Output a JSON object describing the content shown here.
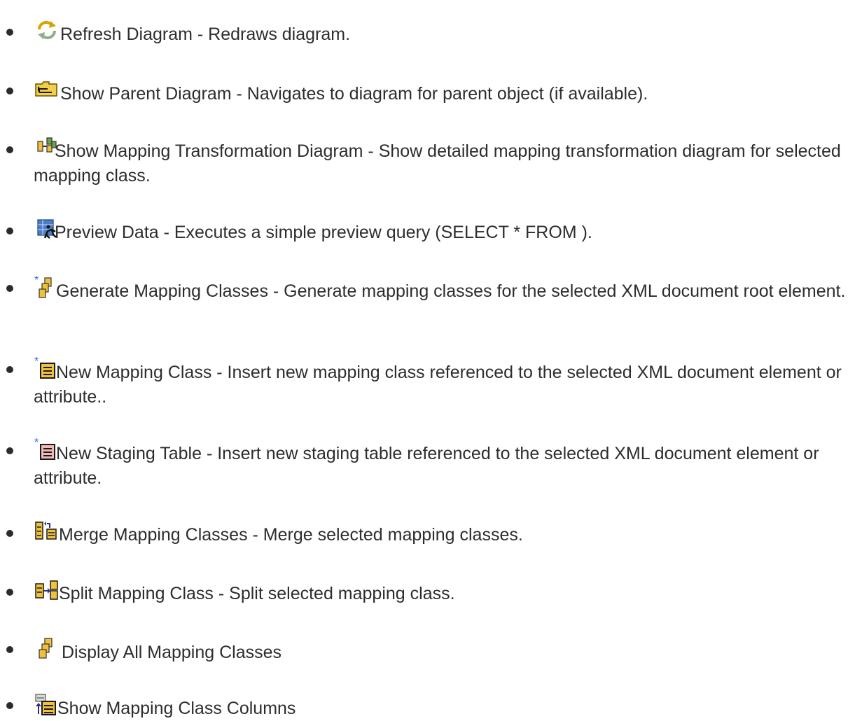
{
  "items": [
    {
      "icon": "refresh-diagram-icon",
      "text": "Refresh Diagram - Redraws diagram."
    },
    {
      "icon": "show-parent-diagram-icon",
      "text": "Show Parent Diagram - Navigates to diagram for parent object (if available)."
    },
    {
      "icon": "mapping-transformation-diagram-icon",
      "text": "Show Mapping Transformation Diagram - Show detailed mapping transformation diagram for selected mapping class."
    },
    {
      "icon": "preview-data-icon",
      "text": "Preview Data - Executes a simple preview query (SELECT * FROM )."
    },
    {
      "icon": "generate-mapping-classes-icon",
      "text": "Generate Mapping Classes - Generate mapping classes for the selected XML document root element."
    },
    {
      "icon": "new-mapping-class-icon",
      "text": "New Mapping Class - Insert new mapping class referenced to the selected XML document element or attribute.."
    },
    {
      "icon": "new-staging-table-icon",
      "text": "New Staging Table - Insert new staging table referenced to the selected XML document element or attribute."
    },
    {
      "icon": "merge-mapping-classes-icon",
      "text": "Merge Mapping Classes - Merge selected mapping classes."
    },
    {
      "icon": "split-mapping-class-icon",
      "text": "Split Mapping Class - Split selected mapping class."
    },
    {
      "icon": "display-all-mapping-classes-icon",
      "text": "Display All Mapping Classes"
    },
    {
      "icon": "show-mapping-class-columns-icon",
      "text": "Show Mapping Class Columns"
    }
  ]
}
